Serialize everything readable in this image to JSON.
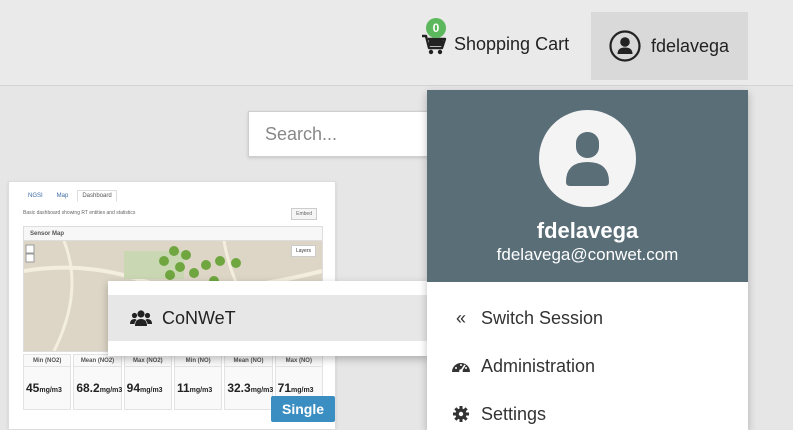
{
  "navbar": {
    "cart_count": "0",
    "cart_label": "Shopping Cart",
    "username": "fdelavega"
  },
  "search": {
    "placeholder": "Search..."
  },
  "card": {
    "tabs": [
      "NGSI",
      "Map",
      "Dashboard"
    ],
    "description": "Basic dashboard showing RT entities and statistics",
    "embed_label": "Embed",
    "map_title": "Sensor Map",
    "layers_label": "Layers",
    "stats": [
      {
        "label": "Min (NO2)",
        "value": "45",
        "unit": "mg/m3"
      },
      {
        "label": "Mean (NO2)",
        "value": "68.2",
        "unit": "mg/m3"
      },
      {
        "label": "Max (NO2)",
        "value": "94",
        "unit": "mg/m3"
      },
      {
        "label": "Min (NO)",
        "value": "11",
        "unit": "mg/m3"
      },
      {
        "label": "Mean (NO)",
        "value": "32.3",
        "unit": "mg/m3"
      },
      {
        "label": "Max (NO)",
        "value": "71",
        "unit": "mg/m3"
      }
    ],
    "badge": "Single"
  },
  "org_menu": {
    "item_label": "CoNWeT"
  },
  "user_panel": {
    "name": "fdelavega",
    "email": "fdelavega@conwet.com",
    "items": [
      {
        "label": "Switch Session",
        "icon": "double-chevron-left-icon"
      },
      {
        "label": "Administration",
        "icon": "dashboard-gauge-icon"
      },
      {
        "label": "Settings",
        "icon": "gear-icon"
      }
    ]
  },
  "colors": {
    "user_header_bg": "#5a6e78",
    "badge_green": "#5cb85c",
    "single_blue": "#3b8ec2"
  }
}
